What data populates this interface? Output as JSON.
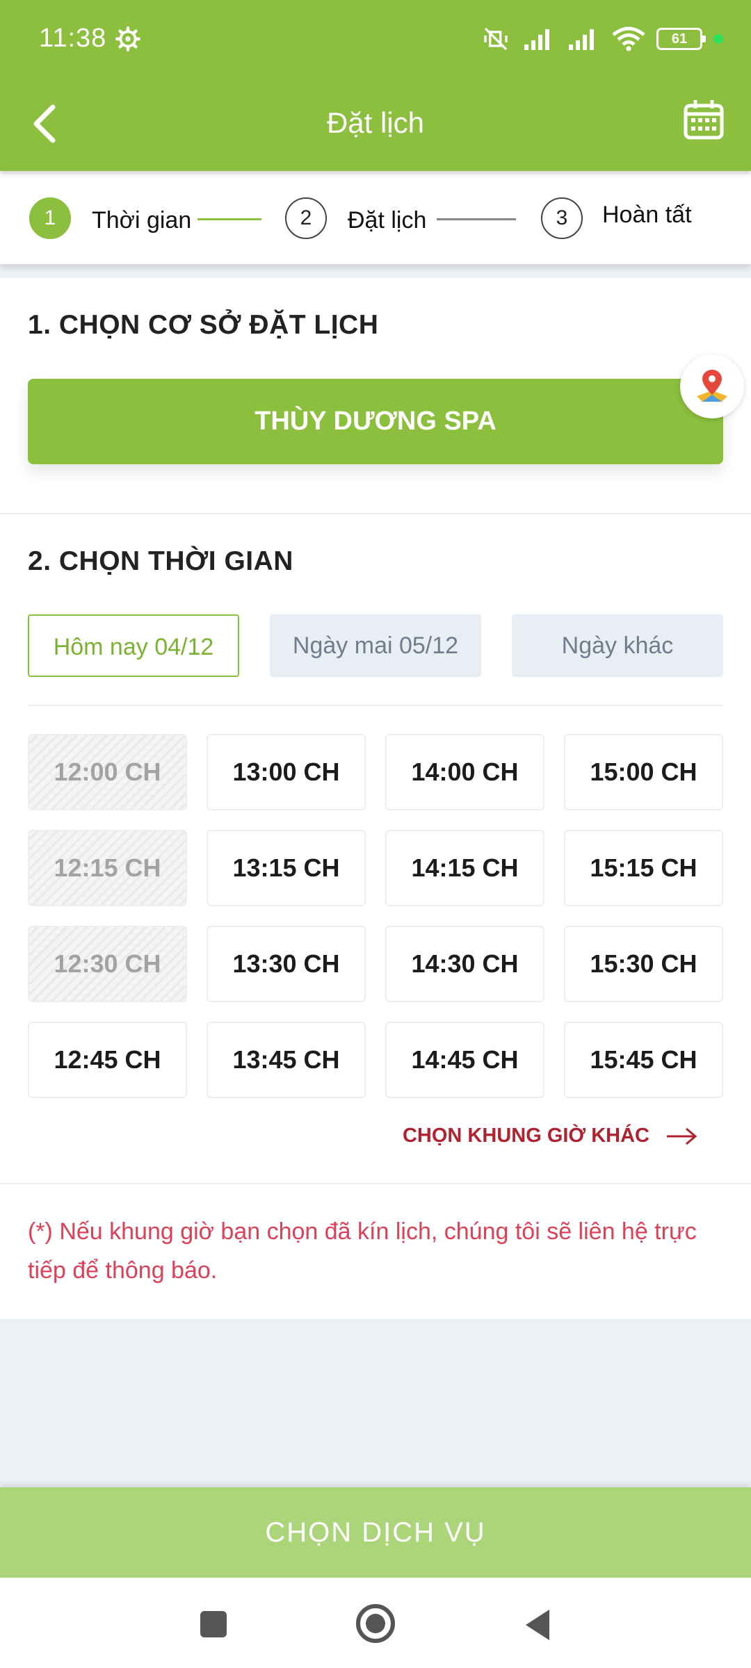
{
  "status_bar": {
    "time": "11:38",
    "battery": "61"
  },
  "app_bar": {
    "title": "Đặt lịch"
  },
  "stepper": {
    "steps": [
      {
        "number": "1",
        "label": "Thời gian"
      },
      {
        "number": "2",
        "label": "Đặt lịch"
      },
      {
        "number": "3",
        "label": "Hoàn tất"
      }
    ],
    "active_step": 1
  },
  "section1": {
    "title": "1. CHỌN CƠ SỞ ĐẶT LỊCH",
    "spa_name": "THÙY DƯƠNG SPA"
  },
  "section2": {
    "title": "2. CHỌN THỜI GIAN",
    "date_tabs": [
      "Hôm nay 04/12",
      "Ngày mai 05/12",
      "Ngày khác"
    ],
    "selected_tab": 0,
    "time_slots": [
      [
        "12:00 CH",
        "13:00 CH",
        "14:00 CH",
        "15:00 CH"
      ],
      [
        "12:15 CH",
        "13:15 CH",
        "14:15 CH",
        "15:15 CH"
      ],
      [
        "12:30 CH",
        "13:30 CH",
        "14:30 CH",
        "15:30 CH"
      ],
      [
        "12:45 CH",
        "13:45 CH",
        "14:45 CH",
        "15:45 CH"
      ]
    ],
    "disabled_slots": [
      "12:00 CH",
      "12:15 CH",
      "12:30 CH"
    ],
    "more_link": "CHỌN KHUNG GIỜ KHÁC",
    "note": "(*) Nếu khung giờ bạn chọn đã kín lịch, chúng tôi sẽ liên hệ trực tiếp để thông báo."
  },
  "bottom_button": {
    "label": "CHỌN DỊCH VỤ"
  },
  "colors": {
    "primary": "#8bbf3d",
    "primary_light": "#acd57a",
    "accent_red": "#b0222f",
    "note_red": "#e04057"
  }
}
